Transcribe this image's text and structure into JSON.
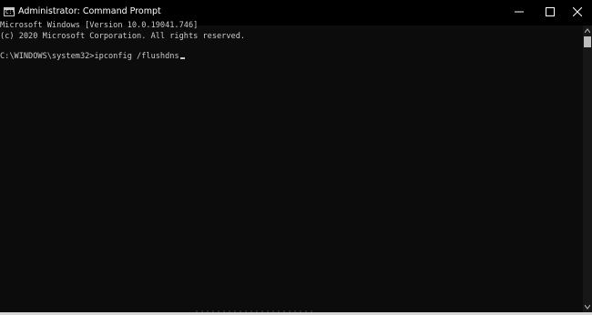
{
  "window": {
    "title": "Administrator: Command Prompt",
    "icon": "cmd-icon",
    "icon_glyph": "C:\\",
    "controls": {
      "minimize_icon": "minimize-icon",
      "maximize_icon": "maximize-icon",
      "close_icon": "close-icon"
    }
  },
  "console": {
    "lines": [
      "Microsoft Windows [Version 10.0.19041.746]",
      "(c) 2020 Microsoft Corporation. All rights reserved."
    ],
    "prompt": "C:\\WINDOWS\\system32>",
    "command": "ipconfig /flushdns"
  },
  "colors": {
    "background": "#0c0c0c",
    "text": "#cccccc",
    "titlebar": "#000000"
  }
}
